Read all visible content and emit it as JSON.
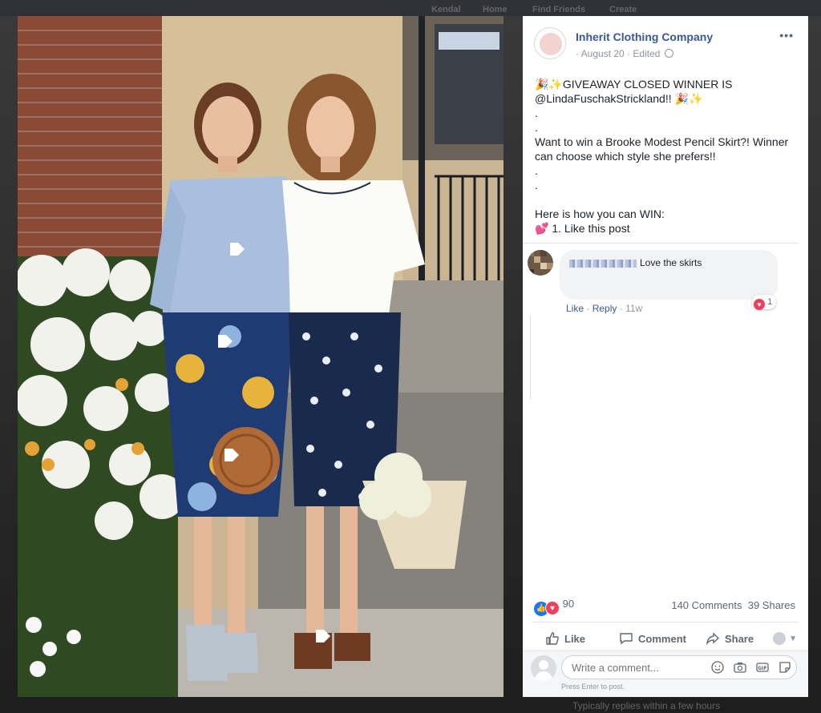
{
  "post": {
    "author": "Inherit Clothing Company",
    "date": "August 20",
    "edited": "Edited",
    "lines": [
      "🎉✨GIVEAWAY CLOSED WINNER IS",
      "@LindaFuschakStrickland!! 🎉✨",
      ".",
      ".",
      "Want to win a Brooke Modest Pencil Skirt?! Winner",
      "can choose which style she prefers!!",
      ".",
      ".",
      "",
      "Here is how you can WIN:",
      "💕 1. Like this post"
    ]
  },
  "comment": {
    "text": "Love the skirts",
    "reaction_count": "1",
    "like_label": "Like",
    "reply_label": "Reply",
    "age": "11w"
  },
  "footer": {
    "reaction_count": "90",
    "comments": "140 Comments",
    "shares": "39 Shares",
    "like_label": "Like",
    "comment_label": "Comment",
    "share_label": "Share",
    "comment_placeholder": "Write a comment...",
    "hint": "Press Enter to post."
  },
  "background": {
    "nav_items": [
      "Kendal",
      "Home",
      "Find Friends",
      "Create"
    ],
    "bottom_text": "Typically replies within a few hours"
  },
  "colors": {
    "link": "#385898",
    "love": "#f33e58",
    "like": "#1877f2"
  }
}
